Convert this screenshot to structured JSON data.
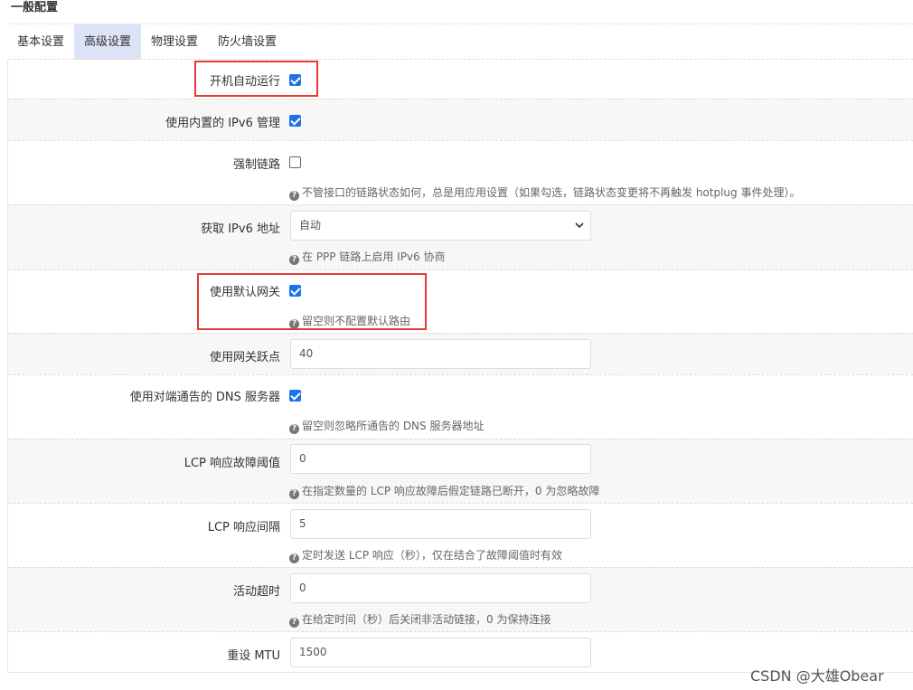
{
  "section_title": "一般配置",
  "tabs": [
    {
      "label": "基本设置",
      "active": false
    },
    {
      "label": "高级设置",
      "active": true
    },
    {
      "label": "物理设置",
      "active": false
    },
    {
      "label": "防火墙设置",
      "active": false
    }
  ],
  "fields": {
    "auto_start": {
      "label": "开机自动运行",
      "checked": true
    },
    "ipv6_mgmt": {
      "label": "使用内置的 IPv6 管理",
      "checked": true
    },
    "force_link": {
      "label": "强制链路",
      "checked": false,
      "hint": "不管接口的链路状态如何，总是用应用设置（如果勾选，链路状态变更将不再触发 hotplug 事件处理）。"
    },
    "ipv6_addr": {
      "label": "获取 IPv6 地址",
      "value": "自动",
      "hint": "在 PPP 链路上启用 IPv6 协商"
    },
    "default_gw": {
      "label": "使用默认网关",
      "checked": true,
      "hint": "留空则不配置默认路由"
    },
    "gw_metric": {
      "label": "使用网关跃点",
      "value": "40"
    },
    "peer_dns": {
      "label": "使用对端通告的 DNS 服务器",
      "checked": true,
      "hint": "留空则忽略所通告的 DNS 服务器地址"
    },
    "lcp_fail": {
      "label": "LCP 响应故障阈值",
      "value": "0",
      "hint": "在指定数量的 LCP 响应故障后假定链路已断开，0 为忽略故障"
    },
    "lcp_interval": {
      "label": "LCP 响应间隔",
      "value": "5",
      "hint": "定时发送 LCP 响应（秒），仅在结合了故障阈值时有效"
    },
    "idle_timeout": {
      "label": "活动超时",
      "value": "0",
      "hint": "在给定时间（秒）后关闭非活动链接，0 为保持连接"
    },
    "mtu": {
      "label": "重设 MTU",
      "value": "1500"
    }
  },
  "hint_icon": "?",
  "watermark": "CSDN @大雄Obear",
  "colors": {
    "accent": "#1a73e8",
    "highlight": "#e53935",
    "active_tab": "#dde3f7"
  }
}
